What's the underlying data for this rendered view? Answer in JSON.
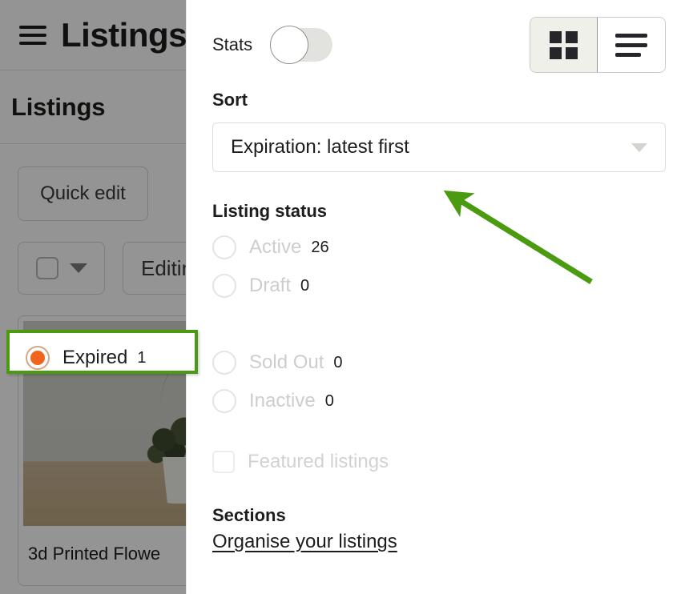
{
  "background": {
    "app_title": "Listings",
    "menu_icon": "hamburger-icon",
    "page_title": "Listings",
    "quick_edit_label": "Quick edit",
    "editing_label": "Editin",
    "card_title": "3d Printed Flowe"
  },
  "panel": {
    "stats": {
      "label": "Stats",
      "enabled": false
    },
    "view_toggle": {
      "grid_icon": "grid-view-icon",
      "list_icon": "list-view-icon",
      "selected": "grid"
    },
    "sort": {
      "label": "Sort",
      "value": "Expiration: latest first",
      "caret_icon": "chevron-down-icon"
    },
    "listing_status": {
      "label": "Listing status",
      "options": [
        {
          "label": "Active",
          "count": "26",
          "selected": false
        },
        {
          "label": "Draft",
          "count": "0",
          "selected": false
        },
        {
          "label": "Expired",
          "count": "1",
          "selected": true
        },
        {
          "label": "Sold Out",
          "count": "0",
          "selected": false
        },
        {
          "label": "Inactive",
          "count": "0",
          "selected": false
        }
      ]
    },
    "featured": {
      "label": "Featured listings",
      "checked": false
    },
    "sections": {
      "label": "Sections",
      "link_label": "Organise your listings"
    }
  },
  "annotation": {
    "arrow_color": "#4b9b10",
    "highlight_color": "#4b9b10",
    "radio_selected_color": "#f1641e"
  }
}
